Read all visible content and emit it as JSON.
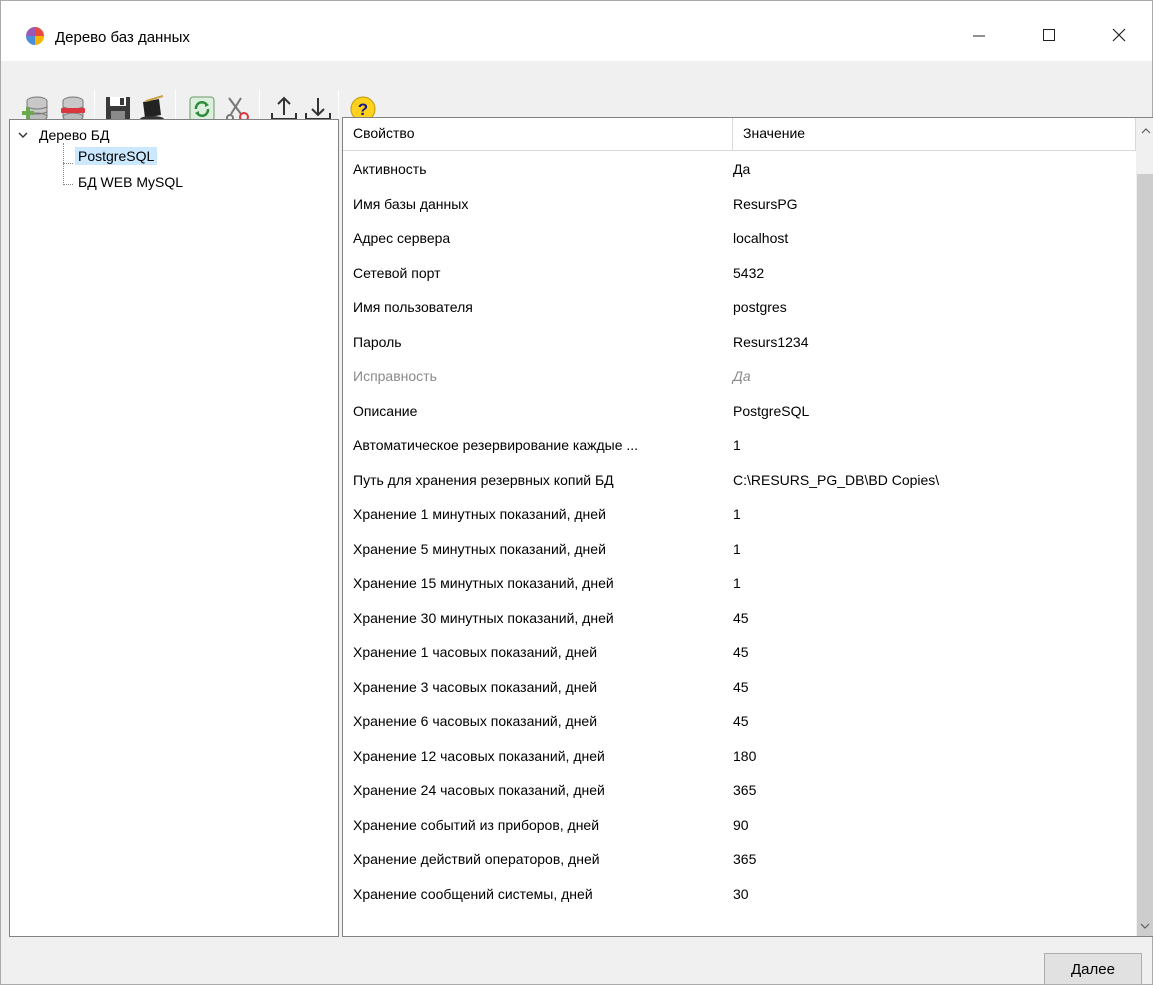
{
  "window": {
    "title": "Дерево баз данных",
    "minimize_icon": "minimize-icon",
    "maximize_icon": "maximize-icon",
    "close_icon": "close-icon"
  },
  "toolbar": {
    "buttons": [
      {
        "icon": "add-database-icon"
      },
      {
        "icon": "delete-database-icon"
      },
      {
        "icon": "save-icon"
      },
      {
        "icon": "magic-hat-icon"
      },
      {
        "icon": "refresh-icon"
      },
      {
        "icon": "scissors-icon"
      },
      {
        "icon": "upload-icon"
      },
      {
        "icon": "download-icon"
      },
      {
        "icon": "help-icon"
      }
    ]
  },
  "tree": {
    "root_label": "Дерево БД",
    "items": [
      {
        "label": "PostgreSQL",
        "selected": true
      },
      {
        "label": "БД WEB MySQL",
        "selected": false
      }
    ]
  },
  "grid": {
    "col_property": "Свойство",
    "col_value": "Значение",
    "rows": [
      {
        "prop": "Активность",
        "val": "Да"
      },
      {
        "prop": "Имя базы данных",
        "val": "ResursPG"
      },
      {
        "prop": "Адрес сервера",
        "val": "localhost"
      },
      {
        "prop": "Сетевой порт",
        "val": "5432"
      },
      {
        "prop": "Имя пользователя",
        "val": "postgres"
      },
      {
        "prop": "Пароль",
        "val": "Resurs1234"
      },
      {
        "prop": "Исправность",
        "val": "Да"
      },
      {
        "prop": "Описание",
        "val": "PostgreSQL"
      },
      {
        "prop": "Автоматическое резервирование каждые ...",
        "val": "1"
      },
      {
        "prop": "Путь для хранения резервных копий БД",
        "val": "C:\\RESURS_PG_DB\\BD Copies\\"
      },
      {
        "prop": "Хранение 1 минутных показаний, дней",
        "val": "1"
      },
      {
        "prop": "Хранение 5 минутных показаний, дней",
        "val": "1"
      },
      {
        "prop": "Хранение 15 минутных показаний, дней",
        "val": "1"
      },
      {
        "prop": "Хранение 30 минутных показаний, дней",
        "val": "45"
      },
      {
        "prop": "Хранение 1 часовых показаний, дней",
        "val": "45"
      },
      {
        "prop": "Хранение 3 часовых показаний, дней",
        "val": "45"
      },
      {
        "prop": "Хранение 6 часовых показаний, дней",
        "val": "45"
      },
      {
        "prop": "Хранение 12 часовых показаний, дней",
        "val": "180"
      },
      {
        "prop": "Хранение 24 часовых показаний, дней",
        "val": "365"
      },
      {
        "prop": "Хранение событий из приборов, дней",
        "val": "90"
      },
      {
        "prop": "Хранение действий операторов, дней",
        "val": "365"
      },
      {
        "prop": "Хранение сообщений системы, дней",
        "val": "30"
      }
    ]
  },
  "footer": {
    "next_label": "Далее"
  }
}
